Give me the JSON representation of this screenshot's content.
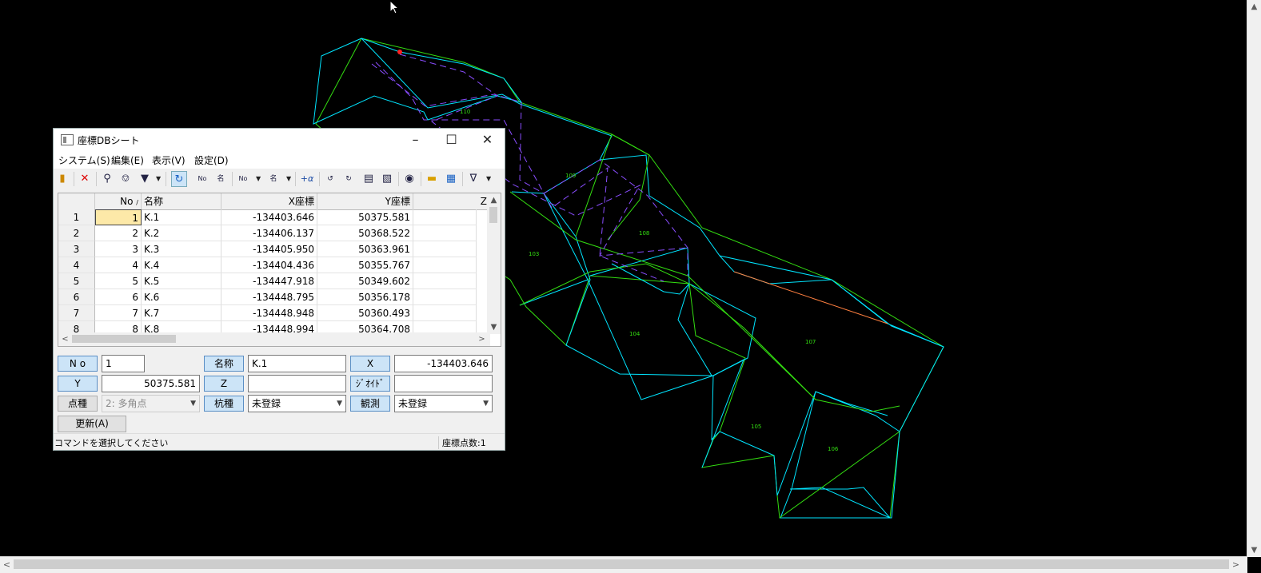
{
  "dialog": {
    "title": "座標DBシート",
    "menus": [
      "システム(S)",
      "編集(E)",
      "表示(V)",
      "設定(D)"
    ],
    "columns": [
      "No",
      "名称",
      "X座標",
      "Y座標",
      "Z"
    ],
    "rows": [
      {
        "row": "1",
        "no": "1",
        "name": "K.1",
        "x": "-134403.646",
        "y": "50375.581"
      },
      {
        "row": "2",
        "no": "2",
        "name": "K.2",
        "x": "-134406.137",
        "y": "50368.522"
      },
      {
        "row": "3",
        "no": "3",
        "name": "K.3",
        "x": "-134405.950",
        "y": "50363.961"
      },
      {
        "row": "4",
        "no": "4",
        "name": "K.4",
        "x": "-134404.436",
        "y": "50355.767"
      },
      {
        "row": "5",
        "no": "5",
        "name": "K.5",
        "x": "-134447.918",
        "y": "50349.602"
      },
      {
        "row": "6",
        "no": "6",
        "name": "K.6",
        "x": "-134448.795",
        "y": "50356.178"
      },
      {
        "row": "7",
        "no": "7",
        "name": "K.7",
        "x": "-134448.948",
        "y": "50360.493"
      },
      {
        "row": "8",
        "no": "8",
        "name": "K.8",
        "x": "-134448.994",
        "y": "50364.708"
      }
    ],
    "form": {
      "no_label": "N o",
      "no_value": "1",
      "name_label": "名称",
      "name_value": "K.1",
      "x_label": "X",
      "x_value": "-134403.646",
      "y_label": "Y",
      "y_value": "50375.581",
      "z_label": "Z",
      "z_value": "",
      "geoid_label": "ｼﾞｵｲﾄﾞ",
      "geoid_value": "",
      "point_type_label": "点種",
      "point_type_value": "2: 多角点",
      "stake_label": "杭種",
      "stake_value": "未登録",
      "obs_label": "観測",
      "obs_value": "未登録",
      "update_button": "更新(A)"
    },
    "status": {
      "message": "コマンドを選択してください",
      "count": "座標点数:1"
    }
  },
  "canvas": {
    "area_labels": [
      "110",
      "109",
      "108",
      "103",
      "104",
      "107",
      "105",
      "106"
    ]
  },
  "colors": {
    "background": "#000000",
    "cyan": "#00e5ff",
    "green": "#33dd11",
    "purple": "#8a4dff",
    "orange": "#ff7f3f"
  }
}
